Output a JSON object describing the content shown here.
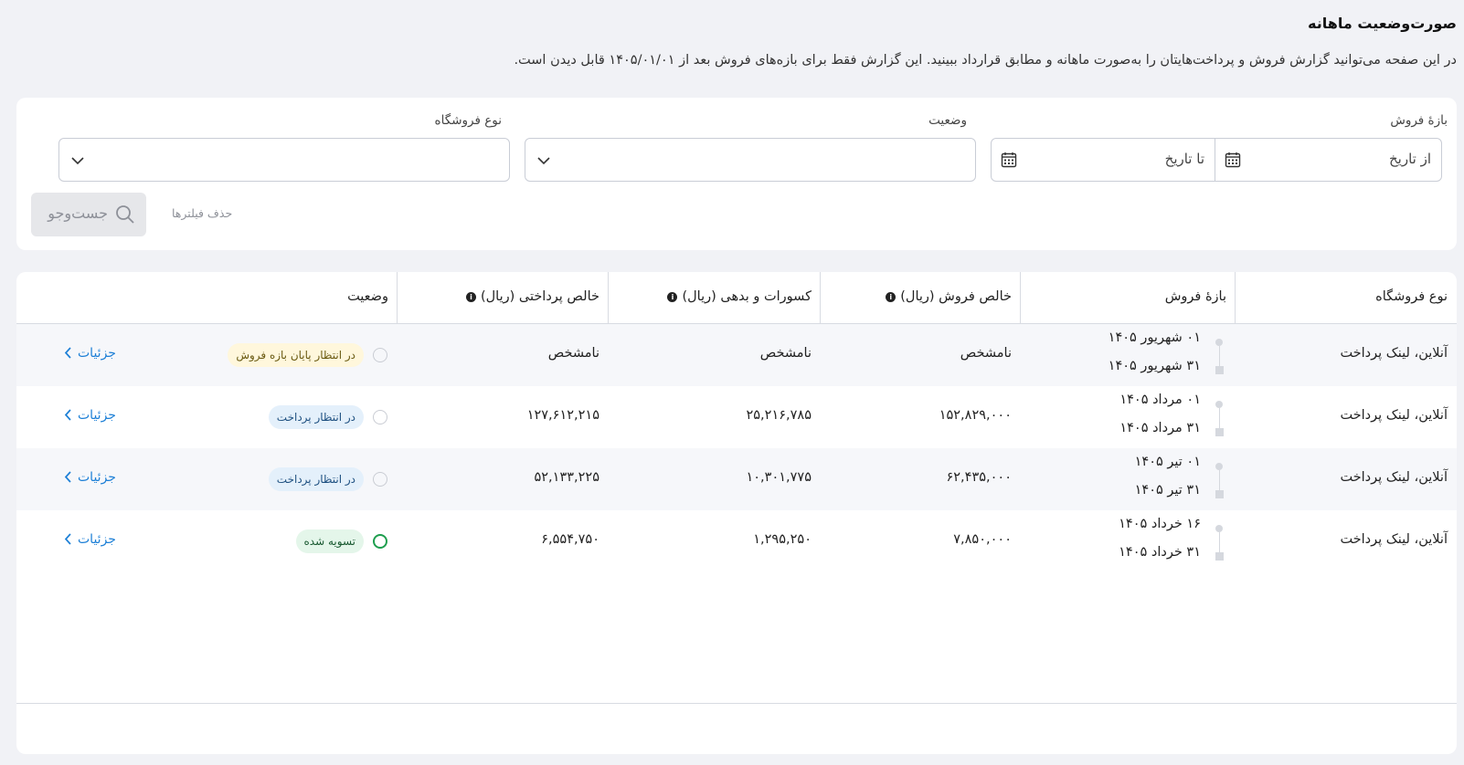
{
  "page": {
    "title": "صورت‌وضعیت ماهانه",
    "description": "در این صفحه می‌توانید گزارش فروش و پرداخت‌هایتان را به‌صورت ماهانه و مطابق قرارداد ببینید. این گزارش فقط برای بازه‌های فروش بعد از ۱۴۰۵/۰۱/۰۱ قابل دیدن است."
  },
  "filters": {
    "sales_period_label": "بازهٔ فروش",
    "from_date_placeholder": "از تاریخ",
    "to_date_placeholder": "تا تاریخ",
    "status_label": "وضعیت",
    "store_type_label": "نوع فروشگاه",
    "search_button": "جست‌وجو",
    "clear_filters": "حذف فیلترها"
  },
  "table": {
    "headers": {
      "store_type": "نوع فروشگاه",
      "sales_period": "بازهٔ فروش",
      "net_sales": "خالص فروش (ریال)",
      "deductions": "کسورات و بدهی (ریال)",
      "net_payment": "خالص پرداختی (ریال)",
      "status": "وضعیت"
    },
    "rows": [
      {
        "store_type": "آنلاین، لینک پرداخت",
        "period_start": "۰۱ شهریور ۱۴۰۵",
        "period_end": "۳۱ شهریور ۱۴۰۵",
        "net_sales": "نامشخص",
        "deductions": "نامشخص",
        "net_payment": "نامشخص",
        "status": "در انتظار پایان بازه فروش",
        "status_color": "#fff7dc",
        "details": "جزئیات"
      },
      {
        "store_type": "آنلاین، لینک پرداخت",
        "period_start": "۰۱ مرداد ۱۴۰۵",
        "period_end": "۳۱ مرداد ۱۴۰۵",
        "net_sales": "۱۵۲,۸۲۹,۰۰۰",
        "deductions": "۲۵,۲۱۶,۷۸۵",
        "net_payment": "۱۲۷,۶۱۲,۲۱۵",
        "status": "در انتظار پرداخت",
        "status_color": "#e4f0fb",
        "details": "جزئیات"
      },
      {
        "store_type": "آنلاین، لینک پرداخت",
        "period_start": "۰۱ تیر ۱۴۰۵",
        "period_end": "۳۱ تیر ۱۴۰۵",
        "net_sales": "۶۲,۴۳۵,۰۰۰",
        "deductions": "۱۰,۳۰۱,۷۷۵",
        "net_payment": "۵۲,۱۳۳,۲۲۵",
        "status": "در انتظار پرداخت",
        "status_color": "#e4f0fb",
        "details": "جزئیات"
      },
      {
        "store_type": "آنلاین، لینک پرداخت",
        "period_start": "۱۶ خرداد ۱۴۰۵",
        "period_end": "۳۱ خرداد ۱۴۰۵",
        "net_sales": "۷,۸۵۰,۰۰۰",
        "deductions": "۱,۲۹۵,۲۵۰",
        "net_payment": "۶,۵۵۴,۷۵۰",
        "status": "تسویه شده",
        "status_color": "#e4f6ea",
        "details": "جزئیات"
      }
    ]
  }
}
